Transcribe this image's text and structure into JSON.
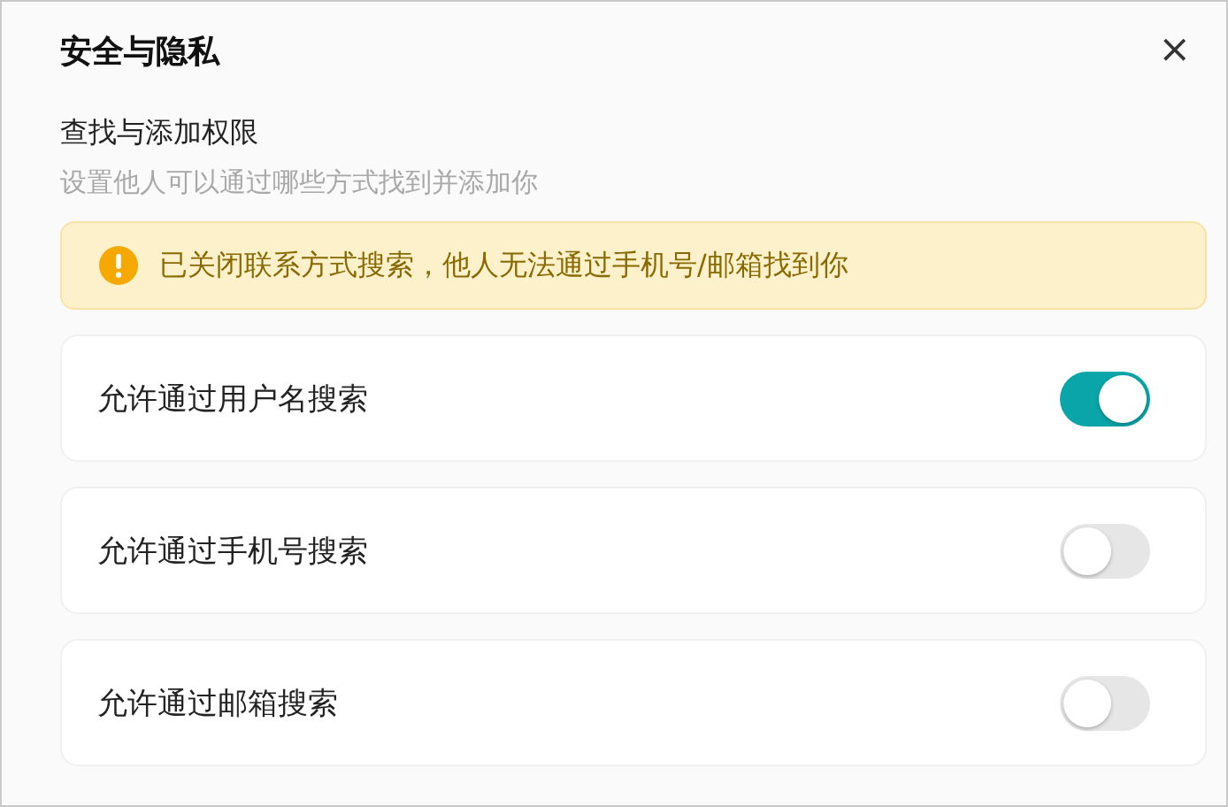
{
  "dialog": {
    "title": "安全与隐私",
    "close": "×"
  },
  "section": {
    "title": "查找与添加权限",
    "description": "设置他人可以通过哪些方式找到并添加你"
  },
  "notice": {
    "kind": "warning",
    "text": "已关闭联系方式搜索，他人无法通过手机号/邮箱找到你"
  },
  "options": [
    {
      "label": "允许通过用户名搜索",
      "on": true
    },
    {
      "label": "允许通过手机号搜索",
      "on": false
    },
    {
      "label": "允许通过邮箱搜索",
      "on": false
    }
  ]
}
